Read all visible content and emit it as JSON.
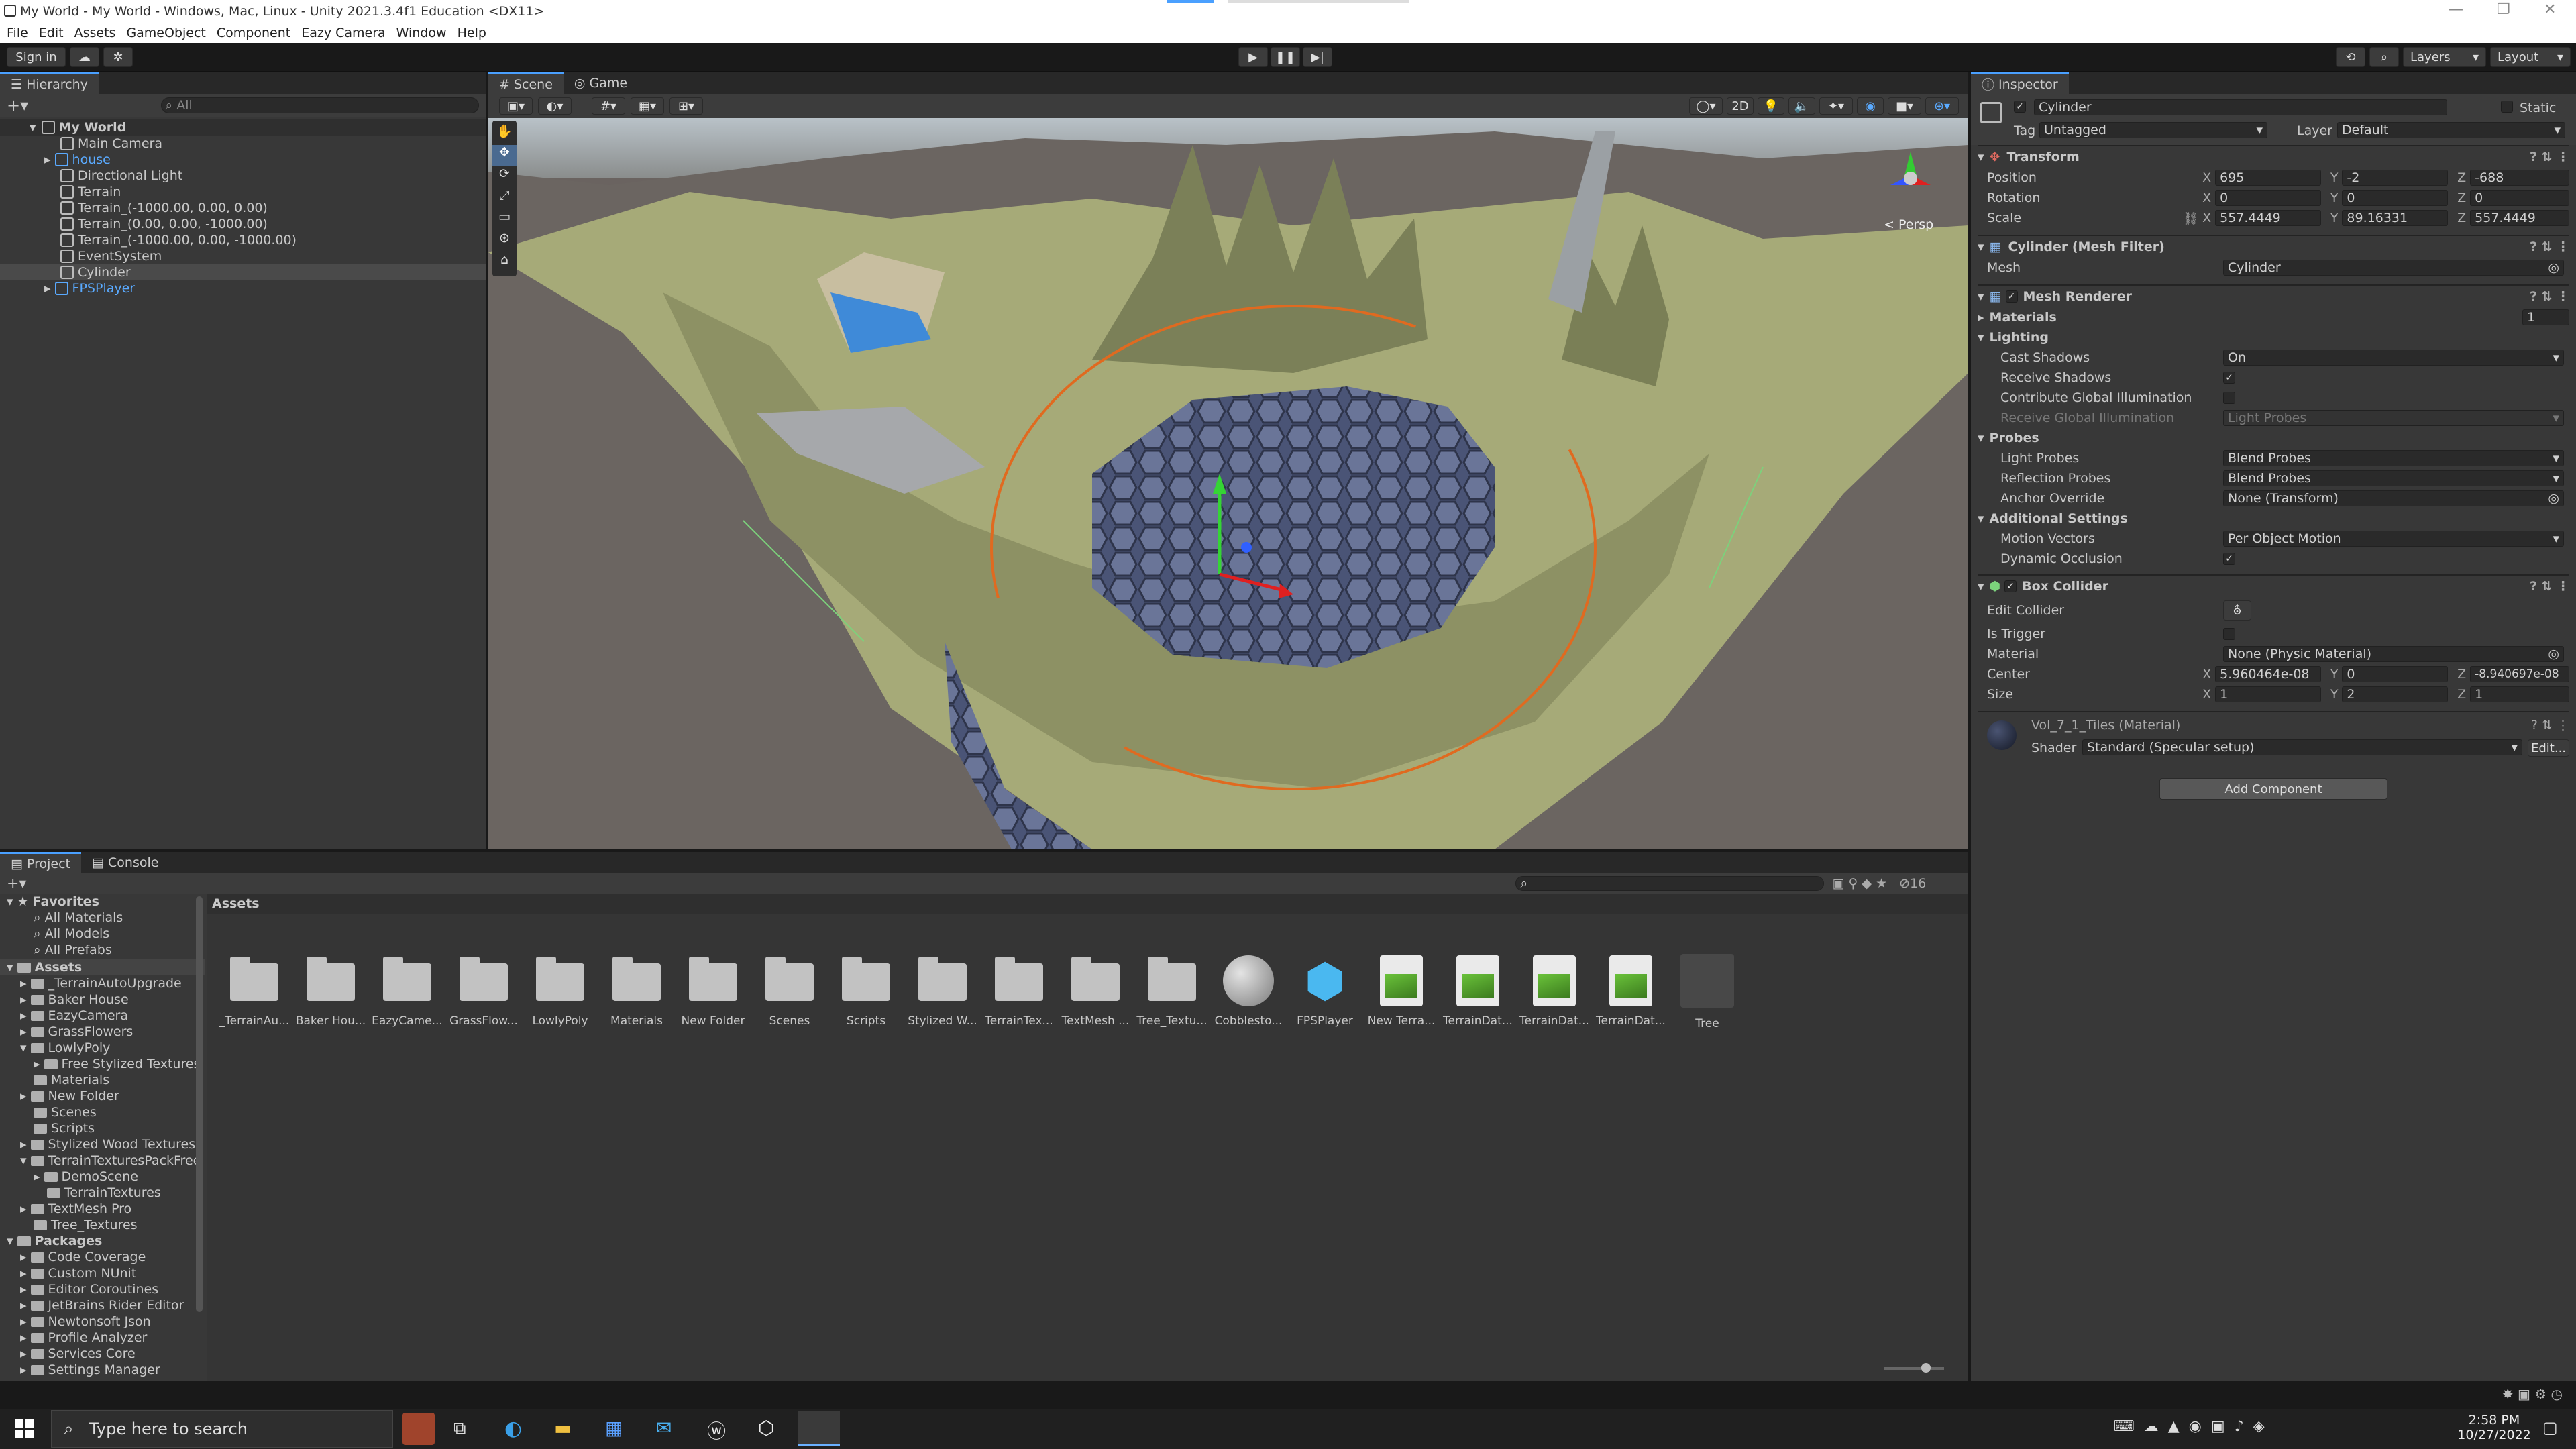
{
  "window": {
    "title": "My World - My World - Windows, Mac, Linux - Unity 2021.3.4f1 Education <DX11>"
  },
  "menu": [
    "File",
    "Edit",
    "Assets",
    "GameObject",
    "Component",
    "Eazy Camera",
    "Window",
    "Help"
  ],
  "toolbar": {
    "sign_in": "Sign in",
    "layers": "Layers",
    "layout": "Layout"
  },
  "hierarchy": {
    "tab": "Hierarchy",
    "search_placeholder": "All",
    "scene": "My World",
    "items": [
      "Main Camera",
      "house",
      "Directional Light",
      "Terrain",
      "Terrain_(-1000.00, 0.00, 0.00)",
      "Terrain_(0.00, 0.00, -1000.00)",
      "Terrain_(-1000.00, 0.00, -1000.00)",
      "EventSystem",
      "Cylinder",
      "FPSPlayer"
    ]
  },
  "scene_tabs": [
    "Scene",
    "Game"
  ],
  "scene": {
    "persp": "< Persp",
    "mode_2d": "2D"
  },
  "inspector": {
    "tab": "Inspector",
    "object_name": "Cylinder",
    "static": "Static",
    "tag_label": "Tag",
    "tag": "Untagged",
    "layer_label": "Layer",
    "layer": "Default",
    "transform": {
      "title": "Transform",
      "position_label": "Position",
      "position": [
        "695",
        "-2",
        "-688"
      ],
      "rotation_label": "Rotation",
      "rotation": [
        "0",
        "0",
        "0"
      ],
      "scale_label": "Scale",
      "scale": [
        "557.4449",
        "89.16331",
        "557.4449"
      ]
    },
    "mesh_filter": {
      "title": "Cylinder (Mesh Filter)",
      "mesh_label": "Mesh",
      "mesh": "Cylinder"
    },
    "mesh_renderer": {
      "title": "Mesh Renderer",
      "materials": "Materials",
      "materials_count": "1",
      "lighting": "Lighting",
      "cast_shadows_label": "Cast Shadows",
      "cast_shadows": "On",
      "receive_shadows": "Receive Shadows",
      "contribute_gi": "Contribute Global Illumination",
      "receive_gi_label": "Receive Global Illumination",
      "receive_gi": "Light Probes",
      "probes": "Probes",
      "light_probes_label": "Light Probes",
      "light_probes": "Blend Probes",
      "reflection_probes_label": "Reflection Probes",
      "reflection_probes": "Blend Probes",
      "anchor_label": "Anchor Override",
      "anchor": "None (Transform)",
      "additional": "Additional Settings",
      "motion_label": "Motion Vectors",
      "motion": "Per Object Motion",
      "dynamic_occlusion": "Dynamic Occlusion"
    },
    "box_collider": {
      "title": "Box Collider",
      "edit_collider": "Edit Collider",
      "is_trigger": "Is Trigger",
      "material_label": "Material",
      "material": "None (Physic Material)",
      "center_label": "Center",
      "center": [
        "5.960464e-08",
        "0",
        "-8.940697e-08"
      ],
      "size_label": "Size",
      "size": [
        "1",
        "2",
        "1"
      ]
    },
    "material": {
      "name": "Vol_7_1_Tiles (Material)",
      "shader_label": "Shader",
      "shader": "Standard (Specular setup)",
      "edit": "Edit..."
    },
    "add_component": "Add Component"
  },
  "project": {
    "tabs": [
      "Project",
      "Console"
    ],
    "count": "16",
    "favorites_title": "Favorites",
    "favorites": [
      "All Materials",
      "All Models",
      "All Prefabs"
    ],
    "assets_title": "Assets",
    "assets_tree": [
      "_TerrainAutoUpgrade",
      "Baker House",
      "EazyCamera",
      "GrassFlowers",
      "LowlyPoly",
      "Free Stylized Textures",
      "Materials",
      "New Folder",
      "Scenes",
      "Scripts",
      "Stylized Wood Textures",
      "TerrainTexturesPackFree",
      "DemoScene",
      "TerrainTextures",
      "TextMesh Pro",
      "Tree_Textures"
    ],
    "packages_title": "Packages",
    "packages": [
      "Code Coverage",
      "Custom NUnit",
      "Editor Coroutines",
      "JetBrains Rider Editor",
      "Newtonsoft Json",
      "Profile Analyzer",
      "Services Core",
      "Settings Manager"
    ],
    "breadcrumb": "Assets",
    "grid": [
      "_TerrainAu...",
      "Baker Hou...",
      "EazyCame...",
      "GrassFlow...",
      "LowlyPoly",
      "Materials",
      "New Folder",
      "Scenes",
      "Scripts",
      "Stylized W...",
      "TerrainTex...",
      "TextMesh ...",
      "Tree_Textu...",
      "Cobblesto...",
      "FPSPlayer",
      "New Terra...",
      "TerrainDat...",
      "TerrainDat...",
      "TerrainDat...",
      "Tree"
    ]
  },
  "taskbar": {
    "search_placeholder": "Type here to search",
    "time": "2:58 PM",
    "date": "10/27/2022"
  }
}
